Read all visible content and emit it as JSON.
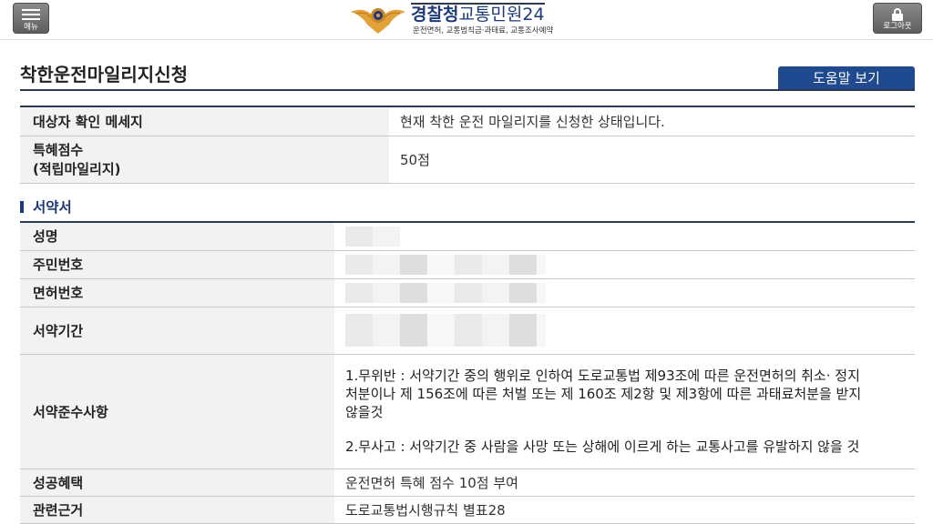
{
  "header": {
    "menu_label": "메뉴",
    "logout_label": "로그아웃",
    "brand_main": "경찰청",
    "brand_service": "교통민원24",
    "brand_subtitle": "운전면허, 교통범칙금·과태료, 교통조사예약",
    "accent_color": "#1f3a7a"
  },
  "page": {
    "title": "착한운전마일리지신청",
    "help_button": "도움말 보기"
  },
  "status_table": {
    "rows": [
      {
        "label": "대상자 확인 메세지",
        "value": "현재 착한 운전 마일리지를 신청한 상태입니다."
      },
      {
        "label_line1": "특혜점수",
        "label_line2": "(적립마일리지)",
        "value": "50점"
      }
    ]
  },
  "pledge": {
    "section_title": "서약서",
    "rows": {
      "name_label": "성명",
      "rrn_label": "주민번호",
      "license_label": "면허번호",
      "period_label": "서약기간",
      "compliance_label": "서약준수사항",
      "compliance_1": "1.무위반 : 서약기간 중의 행위로 인하여 도로교통법 제93조에 따른 운전면허의 취소· 정지처분이나 제 156조에 따른 처벌 또는 제 160조 제2항 및 제3항에 따른 과태료처분을 받지않을것",
      "compliance_2": "2.무사고 : 서약기간 중 사람을 사망 또는 상해에 이르게 하는 교통사고를 유발하지 않을 것",
      "benefit_label": "성공혜택",
      "benefit_value": "운전면허 특혜 점수 10점 부여",
      "basis_label": "관련근거",
      "basis_value": "도로교통법시행규칙 별표28"
    }
  }
}
